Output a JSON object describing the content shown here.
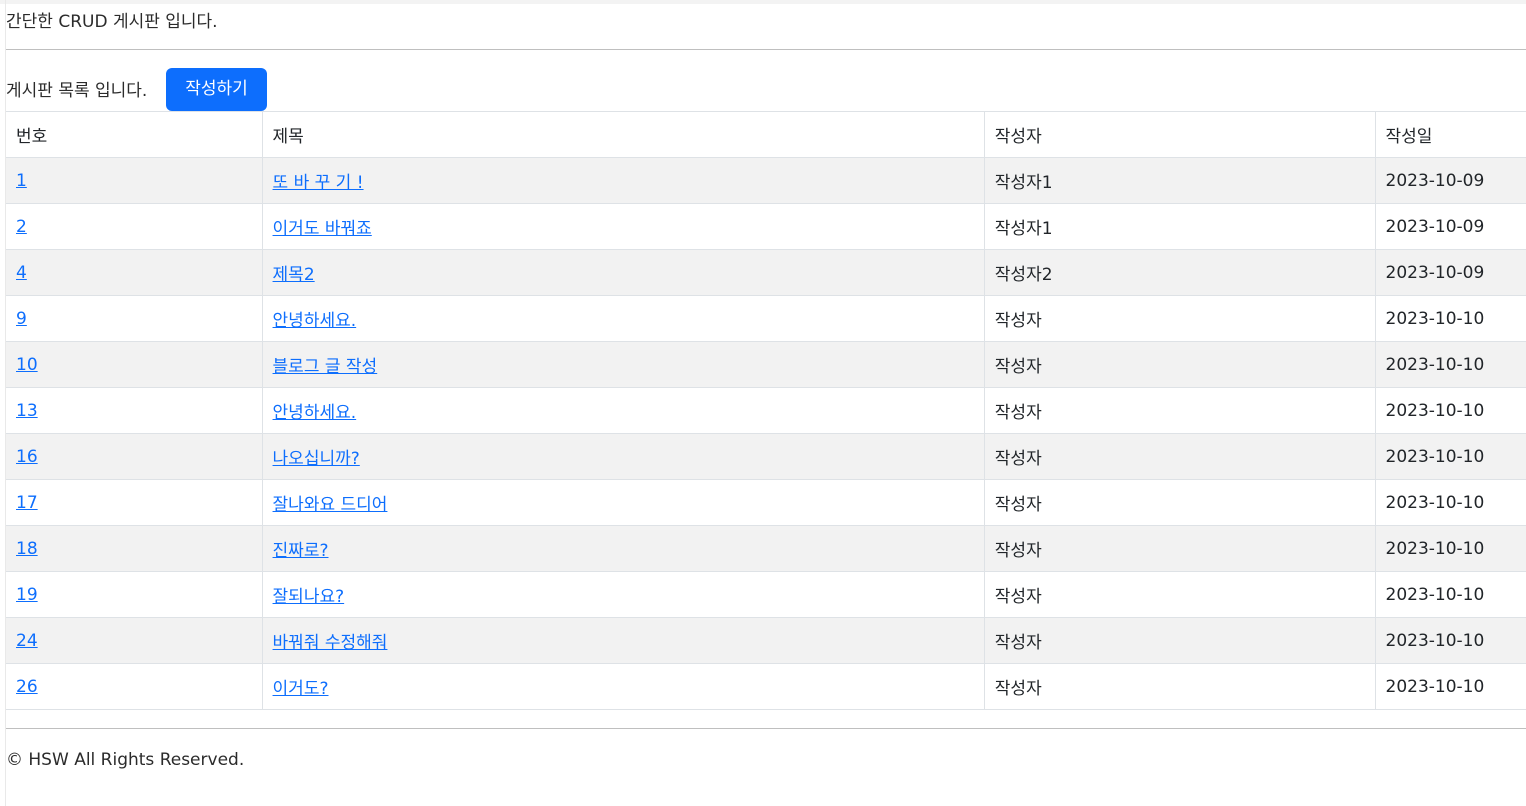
{
  "header": {
    "text": "간단한 CRUD 게시판 입니다."
  },
  "board": {
    "intro": "게시판 목록 입니다.",
    "write_button": "작성하기",
    "columns": [
      "번호",
      "제목",
      "작성자",
      "작성일"
    ],
    "rows": [
      {
        "id": "1",
        "title": "또 바 꾸 기 !",
        "author": "작성자1",
        "date": "2023-10-09"
      },
      {
        "id": "2",
        "title": "이거도 바꿔죠",
        "author": "작성자1",
        "date": "2023-10-09"
      },
      {
        "id": "4",
        "title": "제목2",
        "author": "작성자2",
        "date": "2023-10-09"
      },
      {
        "id": "9",
        "title": "안녕하세요.",
        "author": "작성자",
        "date": "2023-10-10"
      },
      {
        "id": "10",
        "title": "블로그 글 작성",
        "author": "작성자",
        "date": "2023-10-10"
      },
      {
        "id": "13",
        "title": "안녕하세요.",
        "author": "작성자",
        "date": "2023-10-10"
      },
      {
        "id": "16",
        "title": "나오십니까?",
        "author": "작성자",
        "date": "2023-10-10"
      },
      {
        "id": "17",
        "title": "잘나와요 드디어",
        "author": "작성자",
        "date": "2023-10-10"
      },
      {
        "id": "18",
        "title": "진짜로?",
        "author": "작성자",
        "date": "2023-10-10"
      },
      {
        "id": "19",
        "title": "잘되나요?",
        "author": "작성자",
        "date": "2023-10-10"
      },
      {
        "id": "24",
        "title": "바꿔줘 수정해줘",
        "author": "작성자",
        "date": "2023-10-10"
      },
      {
        "id": "26",
        "title": "이거도?",
        "author": "작성자",
        "date": "2023-10-10"
      }
    ]
  },
  "footer": {
    "text": "© HSW All Rights Reserved."
  },
  "colors": {
    "primary": "#0d6efd",
    "stripe": "#f2f2f2",
    "border": "#dee2e6"
  }
}
